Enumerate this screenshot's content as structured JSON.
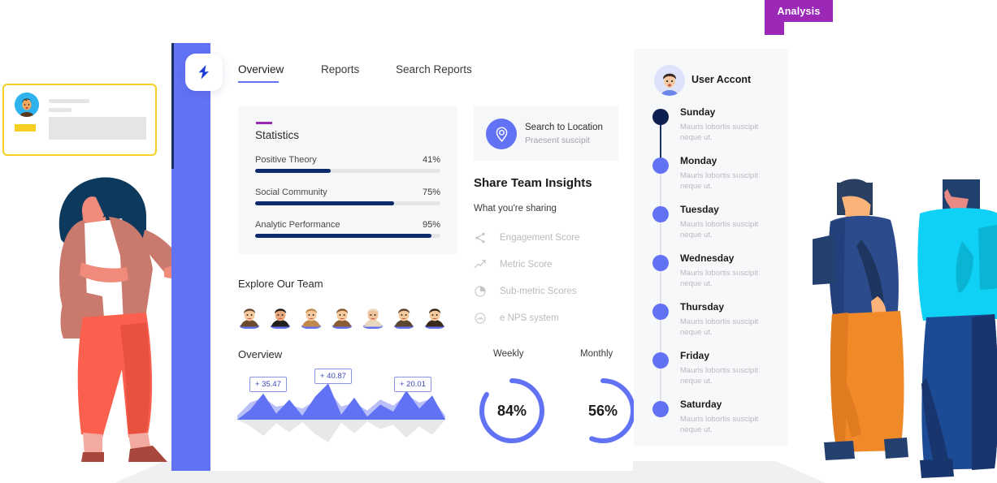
{
  "badge": {
    "label": "Analysis",
    "color": "#9b28b7"
  },
  "brand": {
    "logo_icon": "lightning-bolt-icon",
    "panel_color": "#6272f4"
  },
  "tabs": [
    {
      "label": "Overview",
      "active": true
    },
    {
      "label": "Reports",
      "active": false
    },
    {
      "label": "Search Reports",
      "active": false
    }
  ],
  "statistics": {
    "title": "Statistics",
    "accent": "#9b28b7",
    "bar_color": "#0d2b6b",
    "rows": [
      {
        "label": "Positive Theory",
        "value": 41,
        "percent_text": "41%"
      },
      {
        "label": "Social Community",
        "value": 75,
        "percent_text": "75%"
      },
      {
        "label": "Analytic Performance",
        "value": 95,
        "percent_text": "95%"
      }
    ]
  },
  "team": {
    "title": "Explore Our Team",
    "members": [
      {
        "name": "team-avatar-1",
        "hair": "#6b4a2f",
        "skin": "#f5c99b"
      },
      {
        "name": "team-avatar-2",
        "hair": "#22211f",
        "skin": "#e8a97a"
      },
      {
        "name": "team-avatar-3",
        "hair": "#c08a4e",
        "skin": "#f5c99b"
      },
      {
        "name": "team-avatar-4",
        "hair": "#8a5a33",
        "skin": "#f5c99b"
      },
      {
        "name": "team-avatar-5",
        "hair": "#e8d8c0",
        "skin": "#f0c29a"
      },
      {
        "name": "team-avatar-6",
        "hair": "#5c4630",
        "skin": "#f5c99b"
      },
      {
        "name": "team-avatar-7",
        "hair": "#3a2a1c",
        "skin": "#f5c99b"
      }
    ]
  },
  "overview_card": {
    "title": "Overview"
  },
  "location": {
    "icon": "location-pin-icon",
    "title": "Search to Location",
    "subtitle": "Praesent suscipit"
  },
  "share": {
    "title": "Share Team Insights",
    "subtitle": "What you're sharing",
    "items": [
      {
        "icon": "share-nodes-icon",
        "label": "Engagement Score"
      },
      {
        "icon": "trending-up-icon",
        "label": "Metric Score"
      },
      {
        "icon": "pie-chart-icon",
        "label": "Sub-metric Scores"
      },
      {
        "icon": "gauge-icon",
        "label": "e NPS system"
      }
    ]
  },
  "account": {
    "avatar_icon": "user-avatar-icon",
    "name": "User Accont",
    "timeline": [
      {
        "day": "Sunday",
        "desc": "Mauris lobortis suscipit neque ut.",
        "dot": "#0d1f4f"
      },
      {
        "day": "Monday",
        "desc": "Mauris lobortis suscipit neque ut.",
        "dot": "#6272f4"
      },
      {
        "day": "Tuesday",
        "desc": "Mauris lobortis suscipit neque ut.",
        "dot": "#6272f4"
      },
      {
        "day": "Wednesday",
        "desc": "Mauris lobortis suscipit neque ut.",
        "dot": "#6272f4"
      },
      {
        "day": "Thursday",
        "desc": "Mauris lobortis suscipit neque ut.",
        "dot": "#6272f4"
      },
      {
        "day": "Friday",
        "desc": "Mauris lobortis suscipit neque ut.",
        "dot": "#6272f4"
      },
      {
        "day": "Saturday",
        "desc": "Mauris lobortis suscipit neque ut.",
        "dot": "#6272f4"
      }
    ]
  },
  "chart_data": [
    {
      "type": "area",
      "title": "Overview",
      "name": "overview-mountain-chart",
      "xlabel": "",
      "ylabel": "",
      "annotations": [
        {
          "text": "+ 35.47",
          "x": 0.17
        },
        {
          "text": "+ 40.87",
          "x": 0.46
        },
        {
          "text": "+ 20.01",
          "x": 0.82
        }
      ],
      "series": [
        {
          "name": "front",
          "color": "#6272f4",
          "values": [
            0,
            20,
            52,
            12,
            40,
            8,
            46,
            72,
            10,
            44,
            6,
            30,
            16,
            58,
            22,
            48,
            0
          ]
        },
        {
          "name": "back",
          "color": "#b9c0f7",
          "values": [
            8,
            34,
            44,
            26,
            30,
            22,
            38,
            60,
            26,
            34,
            18,
            40,
            28,
            50,
            34,
            42,
            8
          ]
        }
      ],
      "reflection": true
    },
    {
      "type": "pie",
      "name": "weekly-donut",
      "title": "Weekly",
      "values": [
        84,
        16
      ],
      "labels": [
        "complete",
        "remaining"
      ],
      "value_text": "84%",
      "color": "#6272f4"
    },
    {
      "type": "pie",
      "name": "monthly-donut",
      "title": "Monthly",
      "values": [
        56,
        44
      ],
      "labels": [
        "complete",
        "remaining"
      ],
      "value_text": "56%",
      "color": "#6272f4"
    },
    {
      "type": "bar",
      "name": "statistics-progress-bars",
      "title": "Statistics",
      "categories": [
        "Positive Theory",
        "Social Community",
        "Analytic Performance"
      ],
      "values": [
        41,
        75,
        95
      ],
      "ylim": [
        0,
        100
      ],
      "ylabel": "percent"
    }
  ]
}
